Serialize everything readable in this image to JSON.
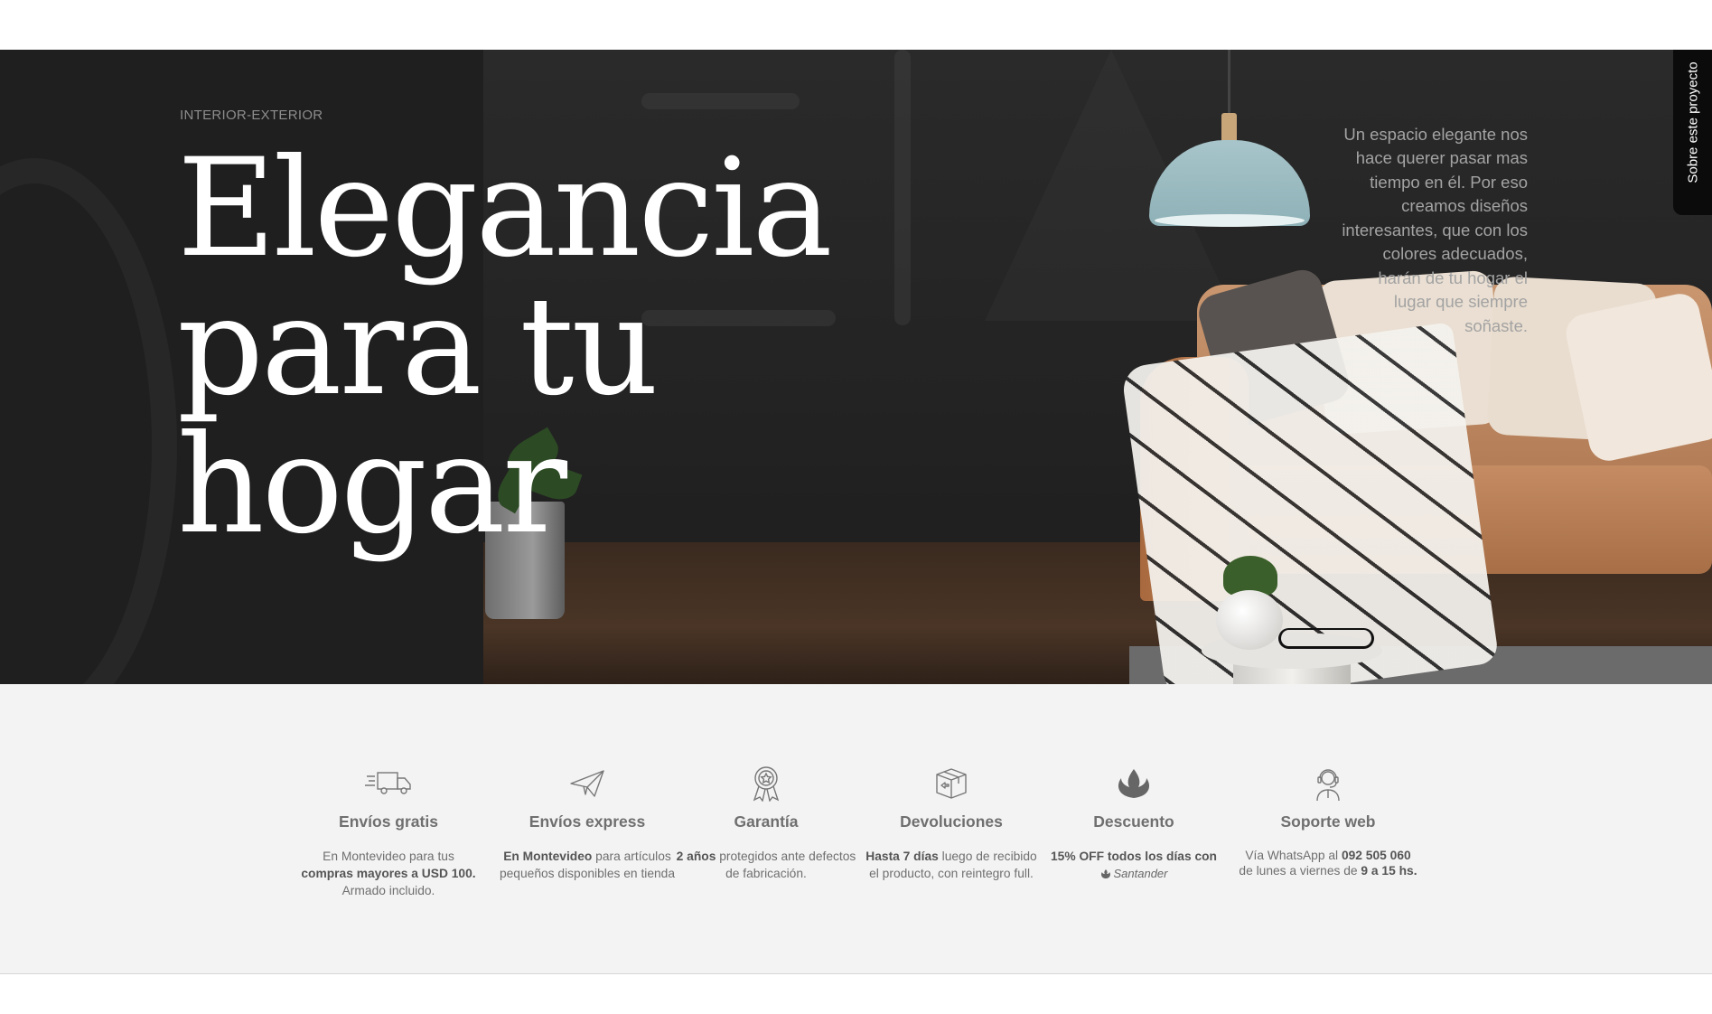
{
  "hero": {
    "tag": "INTERIOR-EXTERIOR",
    "headline_lines": [
      "Elegancia",
      "para tu",
      "hogar"
    ],
    "side_text": "Un espacio elegante nos hace querer pasar mas tiempo en él. Por eso creamos diseños interesantes, que con los colores adecuados, harán de tu hogar el lugar que siempre soñaste.",
    "side_tab_label": "Sobre este proyecto"
  },
  "features": [
    {
      "icon": "truck-icon",
      "title": "Envíos gratis",
      "desc": [
        [
          "En Montevideo para tus ",
          false
        ],
        [
          "compras mayores a USD 100.",
          true
        ],
        [
          " Armado incluido.",
          false
        ]
      ]
    },
    {
      "icon": "paper-plane-icon",
      "title": "Envíos express",
      "desc": [
        [
          "En Montevideo",
          true
        ],
        [
          " para artículos pequeños disponibles en tienda",
          false
        ]
      ]
    },
    {
      "icon": "award-ribbon-icon",
      "title": "Garantía",
      "desc": [
        [
          "2 años",
          true
        ],
        [
          " protegidos ante defectos de fabricación.",
          false
        ]
      ]
    },
    {
      "icon": "box-return-icon",
      "title": "Devoluciones",
      "desc": [
        [
          "Hasta 7 días",
          true
        ],
        [
          " luego de recibido el producto, con reintegro full.",
          false
        ]
      ]
    },
    {
      "icon": "flame-logo-icon",
      "title": "Descuento",
      "desc": [
        [
          "15% OFF todos los días con",
          true
        ]
      ],
      "bank": "Santander"
    },
    {
      "icon": "headset-agent-icon",
      "title": "Soporte web",
      "desc": [
        [
          "Vía WhatsApp al ",
          false
        ],
        [
          "092 505 060",
          true
        ],
        [
          " de lunes a viernes de ",
          false
        ],
        [
          "9 a 15 hs.",
          true
        ]
      ]
    }
  ]
}
